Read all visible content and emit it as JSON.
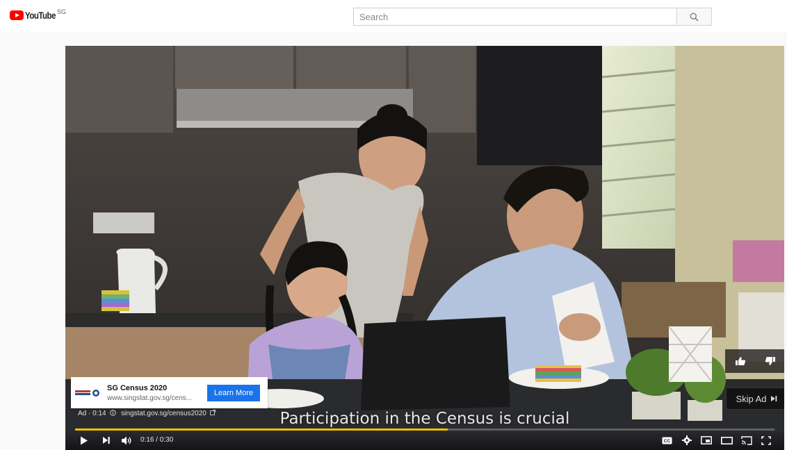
{
  "masthead": {
    "logo_text": "YouTube",
    "region": "SG",
    "search_placeholder": "Search"
  },
  "ad": {
    "title": "SG Census 2020",
    "url": "www.singstat.gov.sg/cens...",
    "cta": "Learn More",
    "info_label": "Ad · 0:14",
    "info_link": "singstat.gov.sg/census2020"
  },
  "player": {
    "caption": "Participation in the Census is crucial",
    "skip_label": "Skip Ad",
    "time": "0:16 / 0:30",
    "progress": 0.533
  },
  "colors": {
    "brand_red": "#ff0000",
    "progress_yellow": "#f3c000",
    "cta_blue": "#1a73e8"
  },
  "icons": [
    "play-icon",
    "next-icon",
    "volume-icon",
    "cc-icon",
    "settings-icon",
    "miniplayer-icon",
    "theater-icon",
    "cast-icon",
    "fullscreen-icon",
    "thumbs-up-icon",
    "thumbs-down-icon",
    "search-icon",
    "info-icon"
  ]
}
